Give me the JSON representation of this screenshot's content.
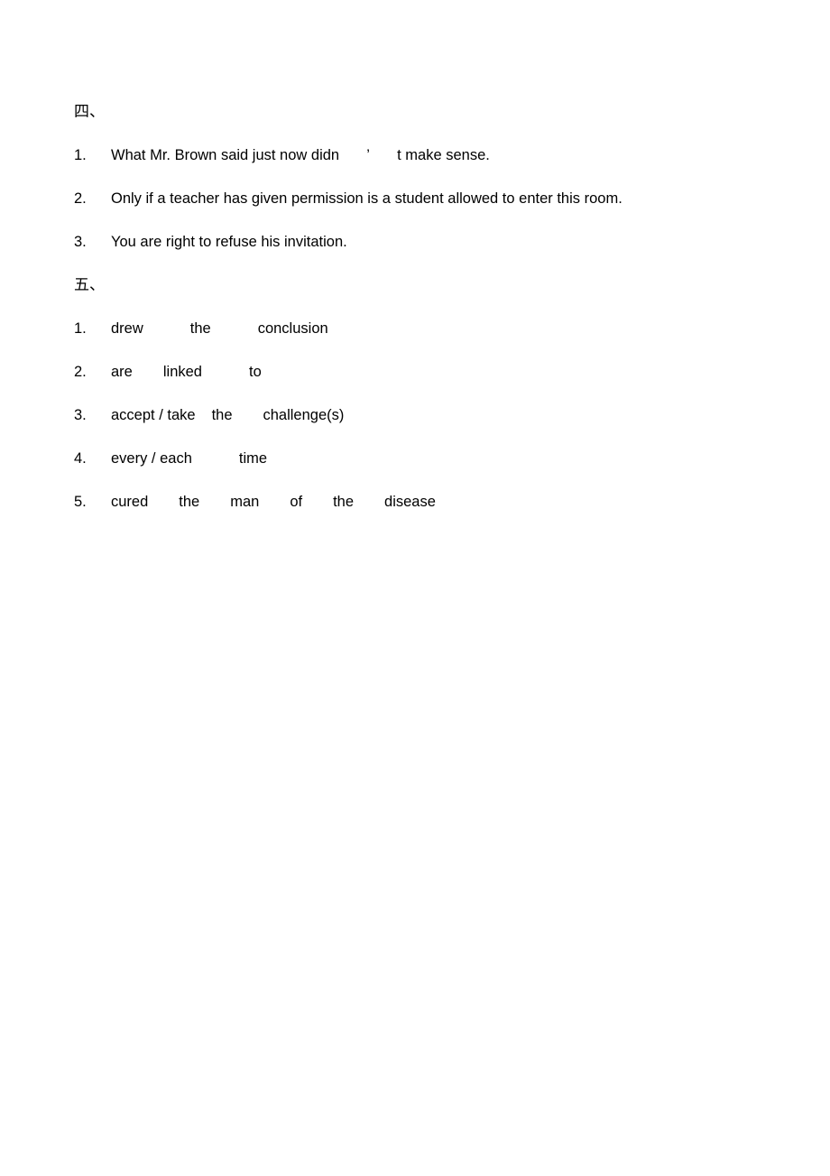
{
  "document": {
    "background_color": "#ffffff",
    "text_color": "#000000",
    "sections": [
      {
        "heading": "四、",
        "items": [
          {
            "number": "1.",
            "before_apostrophe": "What Mr. Brown said just now didn",
            "apostrophe": "’",
            "after_apostrophe": "t make sense."
          },
          {
            "number": "2.",
            "text": "Only if a teacher has given permission is a student allowed to enter this room."
          },
          {
            "number": "3.",
            "text": "You are right to refuse his invitation."
          }
        ]
      },
      {
        "heading": "五、",
        "items": [
          {
            "number": "1.",
            "segments": [
              "drew",
              "the",
              "conclusion"
            ]
          },
          {
            "number": "2.",
            "segments": [
              "are",
              "linked",
              "to"
            ]
          },
          {
            "number": "3.",
            "segments": [
              "accept / take",
              "the",
              "challenge(s)"
            ]
          },
          {
            "number": "4.",
            "segments": [
              "every / each",
              "time"
            ]
          },
          {
            "number": "5.",
            "segments": [
              "cured",
              "the",
              "man",
              "of",
              "the",
              "disease"
            ]
          }
        ]
      }
    ]
  }
}
